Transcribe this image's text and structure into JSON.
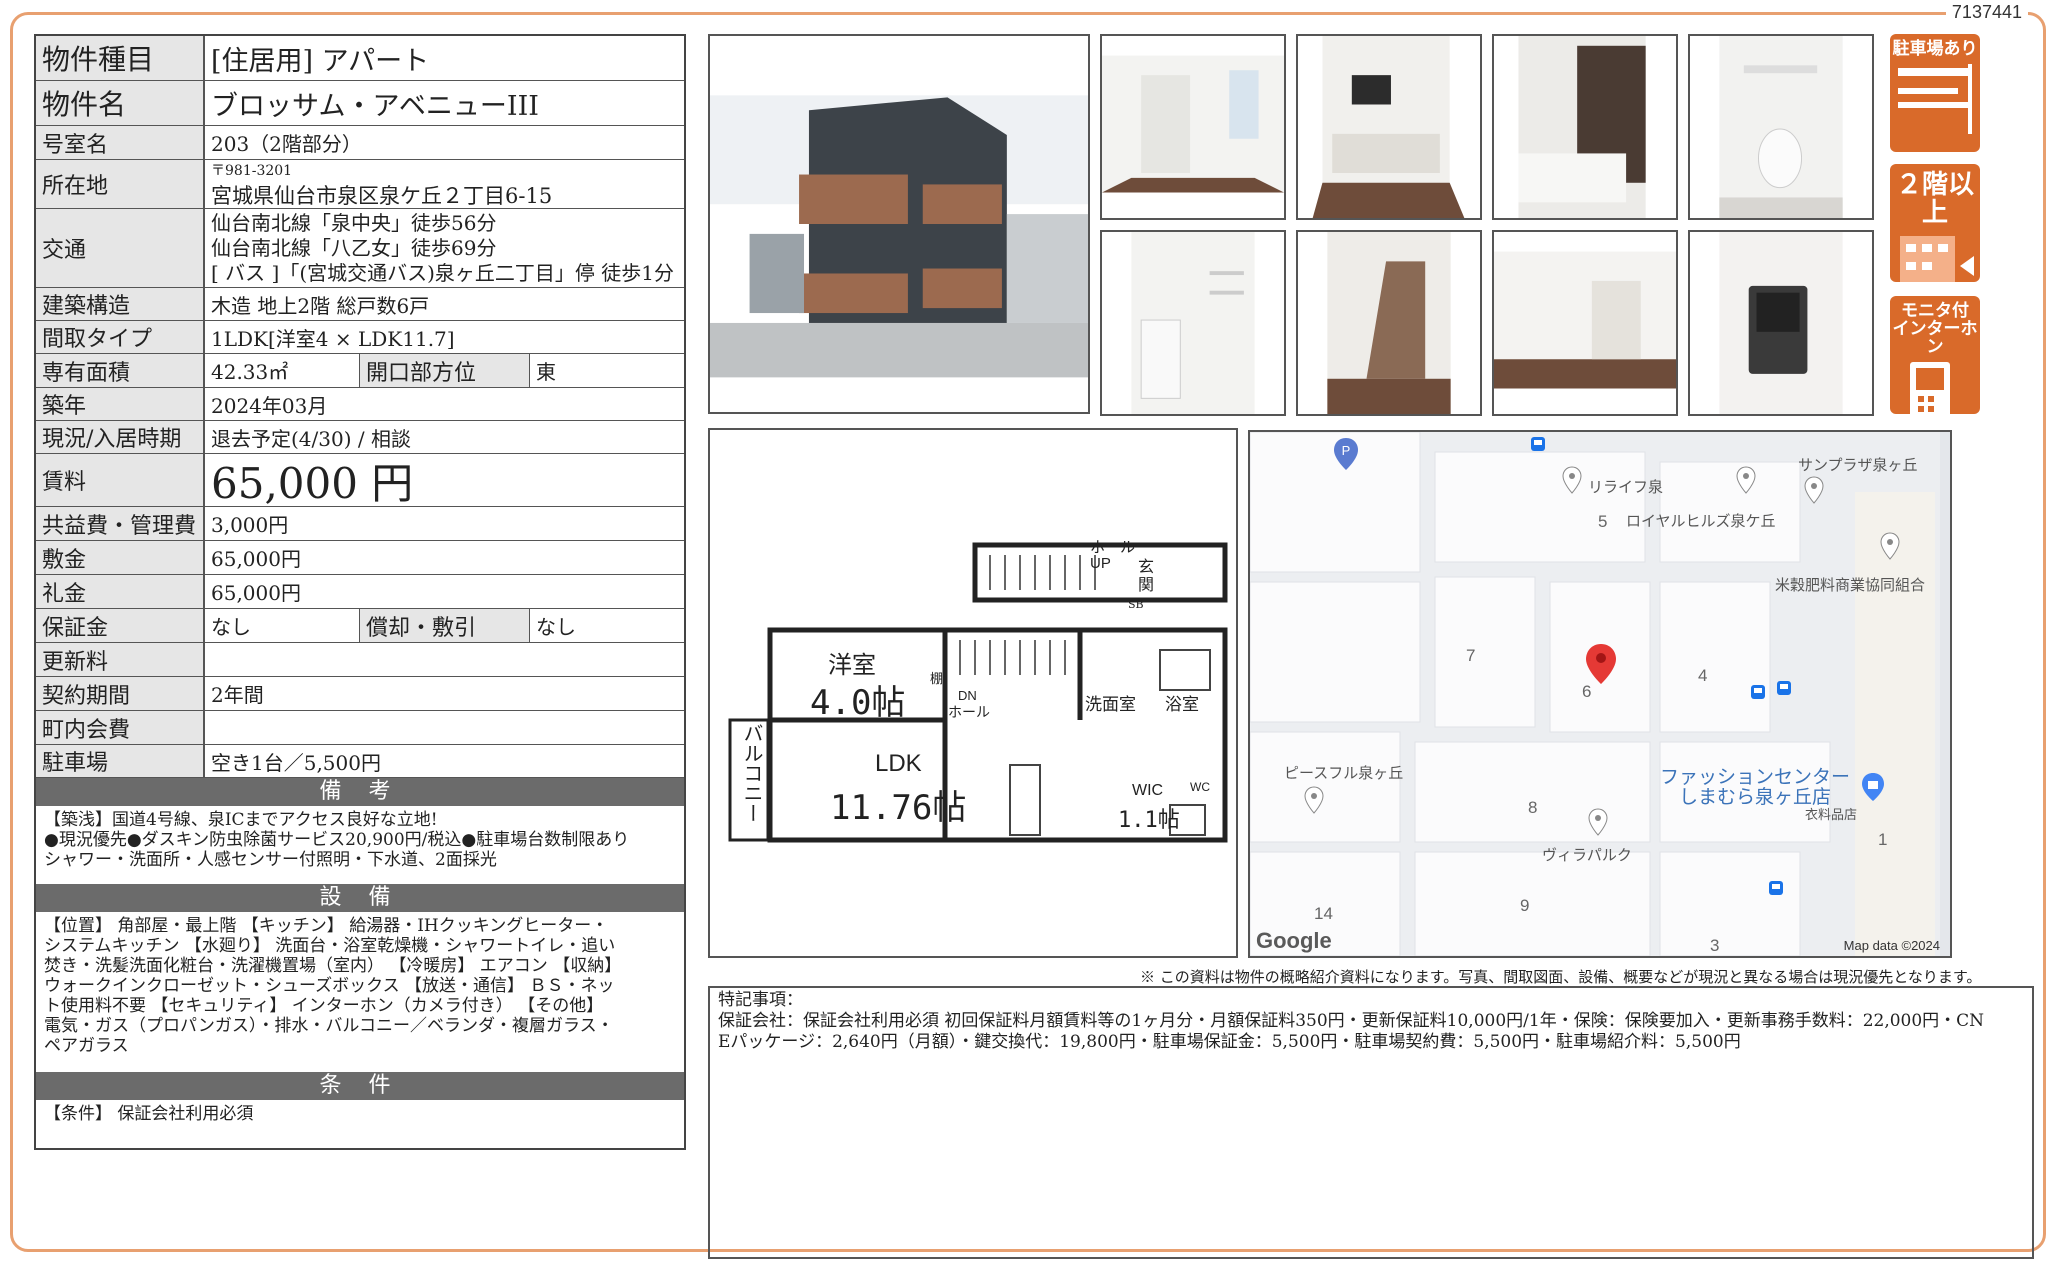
{
  "doc_id": "7137441",
  "property": {
    "type_label": "物件種目",
    "type_value": "[住居用] アパート",
    "name_label": "物件名",
    "name_value": "ブロッサム・アベニューIII",
    "room_label": "号室名",
    "room_value": "203（2階部分）",
    "address_label": "所在地",
    "address_zip": "〒981-3201",
    "address_value": "宮城県仙台市泉区泉ケ丘２丁目6-15",
    "transit_label": "交通",
    "transit_lines": [
      "仙台南北線「泉中央」徒歩56分",
      "仙台南北線「八乙女」徒歩69分",
      "[ バス ]「(宮城交通バス)泉ヶ丘二丁目」停 徒歩1分"
    ],
    "structure_label": "建築構造",
    "structure_value": "木造 地上2階 総戸数6戸",
    "layout_label": "間取タイプ",
    "layout_value": "1LDK[洋室4 × LDK11.7]",
    "area_label": "専有面積",
    "area_value": "42.33㎡",
    "direction_label": "開口部方位",
    "direction_value": "東",
    "built_label": "築年",
    "built_value": "2024年03月",
    "status_label": "現況/入居時期",
    "status_value": "退去予定(4/30) / 相談",
    "rent_label": "賃料",
    "rent_value": "65,000 円",
    "fee_label": "共益費・管理費",
    "fee_value": "3,000円",
    "deposit_label": "敷金",
    "deposit_value": "65,000円",
    "key_money_label": "礼金",
    "key_money_value": "65,000円",
    "guarantee_label": "保証金",
    "guarantee_value": "なし",
    "amort_label": "償却・敷引",
    "amort_value": "なし",
    "renewal_label": "更新料",
    "renewal_value": "",
    "contract_label": "契約期間",
    "contract_value": "2年間",
    "community_label": "町内会費",
    "community_value": "",
    "parking_label": "駐車場",
    "parking_value": "空き1台／5,500円"
  },
  "remarks": {
    "title": "備 考",
    "lines": [
      "【築浅】国道4号線、泉ICまでアクセス良好な立地!",
      "●現況優先●ダスキン防虫除菌サービス20,900円/税込●駐車場台数制限あり",
      "シャワー・洗面所・人感センサー付照明・下水道、2面採光"
    ]
  },
  "equipment": {
    "title": "設 備",
    "lines": [
      "【位置】 角部屋・最上階 【キッチン】 給湯器・IHクッキングヒーター・",
      "システムキッチン 【水廻り】 洗面台・浴室乾燥機・シャワートイレ・追い",
      "焚き・洗髪洗面化粧台・洗濯機置場（室内） 【冷暖房】 エアコン 【収納】",
      "ウォークインクローゼット・シューズボックス 【放送・通信】 ＢＳ・ネッ",
      "ト使用料不要 【セキュリティ】 インターホン（カメラ付き） 【その他】",
      "電気・ガス（プロパンガス）・排水・バルコニー／ベランダ・複層ガラス・",
      "ペアガラス"
    ]
  },
  "conditions": {
    "title": "条 件",
    "lines": [
      "【条件】 保証会社利用必須"
    ]
  },
  "badges": {
    "parking": "駐車場あり",
    "floor": "２階以上",
    "intercom_1": "モニタ付",
    "intercom_2": "インターホン"
  },
  "floorplan": {
    "hall": "ホール",
    "up": "UP",
    "entrance_1": "玄",
    "entrance_2": "関",
    "sb": "SB",
    "western_room": "洋室",
    "western_size": "4.0帖",
    "shelf": "棚",
    "dn": "DN",
    "hall2": "ホール",
    "washroom": "洗面室",
    "bath": "浴室",
    "balcony": "バルコニー",
    "ldk": "LDK",
    "ldk_size": "11.76帖",
    "wic": "WIC",
    "wic_size": "1.1帖",
    "wc": "WC"
  },
  "map": {
    "labels": [
      "リライフ泉",
      "サンプラザ泉ヶ丘",
      "ロイヤルヒルズ泉ケ丘",
      "米穀肥料商業協同組合",
      "ピースフル泉ヶ丘",
      "ヴィラパルク",
      "衣料品店"
    ],
    "shop_1": "ファッションセンター",
    "shop_2": "しまむら泉ヶ丘店",
    "numbers": [
      "5",
      "7",
      "6",
      "4",
      "8",
      "1",
      "14",
      "9",
      "3"
    ],
    "logo": "Google",
    "data": "Map data ©2024"
  },
  "disclaimer": "※ この資料は物件の概略紹介資料になります。写真、間取図面、設備、概要などが現況と異なる場合は現況優先となります。",
  "notes": {
    "title": "特記事項：",
    "lines": [
      "保証会社：保証会社利用必須 初回保証料月額賃料等の1ヶ月分・月額保証料350円・更新保証料10,000円/1年・保険：保険要加入・更新事務手数料：22,000円・CN",
      "Eパッケージ：2,640円（月額）・鍵交換代：19,800円・駐車場保証金：5,500円・駐車場契約費：5,500円・駐車場紹介料：5,500円"
    ]
  },
  "colors": {
    "accent": "#d96a2a",
    "frame": "#e8a070",
    "section": "#6b6b6b"
  }
}
